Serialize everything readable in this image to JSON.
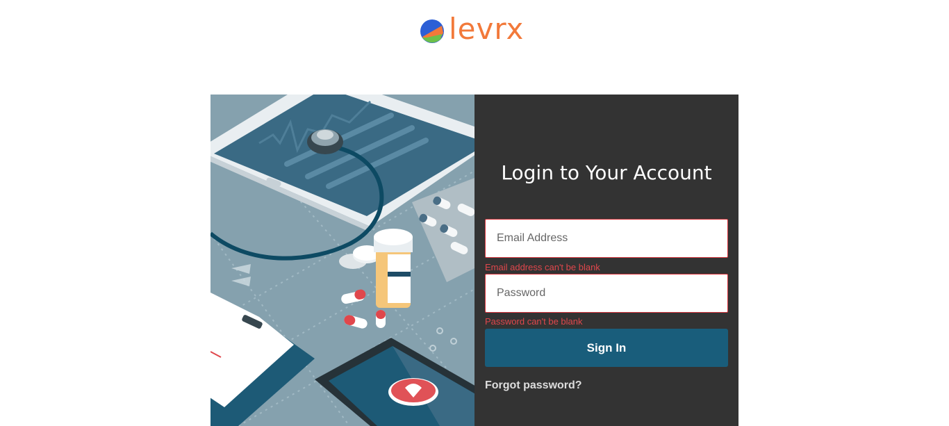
{
  "brand": {
    "name": "levrx",
    "text_color": "#f2793a",
    "mark_colors": [
      "#2c5fd6",
      "#f2793a",
      "#6cc04a"
    ]
  },
  "illustration": {
    "description_icons": [
      "tablet-icon",
      "stethoscope-icon",
      "pill-bottle-icon",
      "pill-blister-icon",
      "capsule-icon",
      "clipboard-icon",
      "phone-heart-icon"
    ],
    "background_color": "#8aa5b2"
  },
  "login": {
    "title": "Login to Your Account",
    "email": {
      "placeholder": "Email Address",
      "value": "",
      "error": "Email address can't be blank"
    },
    "password": {
      "placeholder": "Password",
      "value": "",
      "error": "Password can't be blank"
    },
    "submit_label": "Sign In",
    "forgot_label": "Forgot password?",
    "panel_color": "#333333",
    "button_color": "#195d7b",
    "error_color": "#e0474c"
  }
}
